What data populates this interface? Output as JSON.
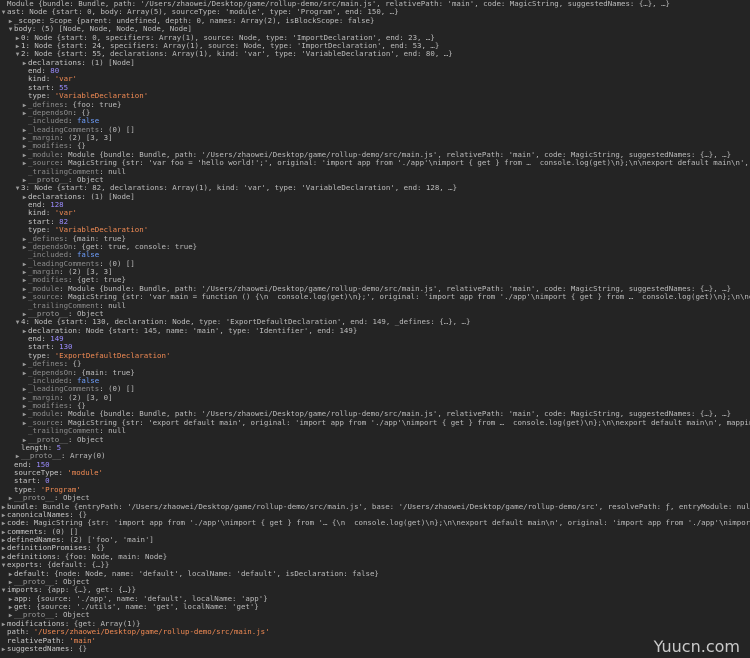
{
  "watermark": "Yuucn.com",
  "lines": [
    {
      "d": 0,
      "t": "none",
      "k": "",
      "v": "Module {bundle: Bundle, path: '/Users/zhaowei/Desktop/game/rollup-demo/src/main.js', relativePath: 'main', code: MagicString, suggestedNames: {…}, …}",
      "vc": "preview"
    },
    {
      "d": 0,
      "t": "open",
      "k": "ast",
      "v": "Node {start: 0, body: Array(5), sourceType: 'module', type: 'Program', end: 150, …}",
      "vc": "preview"
    },
    {
      "d": 1,
      "t": "closed",
      "k": "_scope",
      "v": "Scope {parent: undefined, depth: 0, names: Array(2), isBlockScope: false}",
      "vc": "preview"
    },
    {
      "d": 1,
      "t": "open",
      "k": "body",
      "v": "(5) [Node, Node, Node, Node, Node]",
      "vc": "preview"
    },
    {
      "d": 2,
      "t": "closed",
      "k": "0",
      "v": "Node {start: 0, specifiers: Array(1), source: Node, type: 'ImportDeclaration', end: 23, …}",
      "vc": "preview"
    },
    {
      "d": 2,
      "t": "closed",
      "k": "1",
      "v": "Node {start: 24, specifiers: Array(1), source: Node, type: 'ImportDeclaration', end: 53, …}",
      "vc": "preview"
    },
    {
      "d": 2,
      "t": "open",
      "k": "2",
      "v": "Node {start: 55, declarations: Array(1), kind: 'var', type: 'VariableDeclaration', end: 80, …}",
      "vc": "preview"
    },
    {
      "d": 3,
      "t": "closed",
      "k": "declarations",
      "v": "(1) [Node]",
      "vc": "preview"
    },
    {
      "d": 3,
      "t": "none",
      "k": "end",
      "v": "80",
      "vc": "num"
    },
    {
      "d": 3,
      "t": "none",
      "k": "kind",
      "v": "'var'",
      "vc": "str"
    },
    {
      "d": 3,
      "t": "none",
      "k": "start",
      "v": "55",
      "vc": "num"
    },
    {
      "d": 3,
      "t": "none",
      "k": "type",
      "v": "'VariableDeclaration'",
      "vc": "str"
    },
    {
      "d": 3,
      "t": "closed",
      "k": "_defines",
      "v": "{foo: true}",
      "vc": "preview",
      "kc": "faded"
    },
    {
      "d": 3,
      "t": "closed",
      "k": "_dependsOn",
      "v": "{}",
      "vc": "preview",
      "kc": "faded"
    },
    {
      "d": 3,
      "t": "none",
      "k": "_included",
      "v": "false",
      "vc": "kw",
      "kc": "faded"
    },
    {
      "d": 3,
      "t": "closed",
      "k": "_leadingComments",
      "v": "(0) []",
      "vc": "preview",
      "kc": "faded"
    },
    {
      "d": 3,
      "t": "closed",
      "k": "_margin",
      "v": "(2) [3, 3]",
      "vc": "preview",
      "kc": "faded"
    },
    {
      "d": 3,
      "t": "closed",
      "k": "_modifies",
      "v": "{}",
      "vc": "preview",
      "kc": "faded"
    },
    {
      "d": 3,
      "t": "closed",
      "k": "_module",
      "v": "Module {bundle: Bundle, path: '/Users/zhaowei/Desktop/game/rollup-demo/src/main.js', relativePath: 'main', code: MagicString, suggestedNames: {…}, …}",
      "vc": "preview",
      "kc": "faded"
    },
    {
      "d": 3,
      "t": "closed",
      "k": "_source",
      "v": "MagicString {str: 'var foo = 'hello world!';', original: 'import app from './app'\\nimport { get } from …  console.log(get)\\n};\\n\\nexport default main\\n', mappings: Uint32Array(150), fil",
      "vc": "preview",
      "kc": "faded"
    },
    {
      "d": 3,
      "t": "none",
      "k": "_trailingComment",
      "v": "null",
      "vc": "val",
      "kc": "faded"
    },
    {
      "d": 3,
      "t": "closed",
      "k": "__proto__",
      "v": "Object",
      "vc": "val",
      "kc": "proto"
    },
    {
      "d": 2,
      "t": "open",
      "k": "3",
      "v": "Node {start: 82, declarations: Array(1), kind: 'var', type: 'VariableDeclaration', end: 128, …}",
      "vc": "preview"
    },
    {
      "d": 3,
      "t": "closed",
      "k": "declarations",
      "v": "(1) [Node]",
      "vc": "preview"
    },
    {
      "d": 3,
      "t": "none",
      "k": "end",
      "v": "128",
      "vc": "num"
    },
    {
      "d": 3,
      "t": "none",
      "k": "kind",
      "v": "'var'",
      "vc": "str"
    },
    {
      "d": 3,
      "t": "none",
      "k": "start",
      "v": "82",
      "vc": "num"
    },
    {
      "d": 3,
      "t": "none",
      "k": "type",
      "v": "'VariableDeclaration'",
      "vc": "str"
    },
    {
      "d": 3,
      "t": "closed",
      "k": "_defines",
      "v": "{main: true}",
      "vc": "preview",
      "kc": "faded"
    },
    {
      "d": 3,
      "t": "closed",
      "k": "_dependsOn",
      "v": "{get: true, console: true}",
      "vc": "preview",
      "kc": "faded"
    },
    {
      "d": 3,
      "t": "none",
      "k": "_included",
      "v": "false",
      "vc": "kw",
      "kc": "faded"
    },
    {
      "d": 3,
      "t": "closed",
      "k": "_leadingComments",
      "v": "(0) []",
      "vc": "preview",
      "kc": "faded"
    },
    {
      "d": 3,
      "t": "closed",
      "k": "_margin",
      "v": "(2) [3, 3]",
      "vc": "preview",
      "kc": "faded"
    },
    {
      "d": 3,
      "t": "closed",
      "k": "_modifies",
      "v": "{get: true}",
      "vc": "preview",
      "kc": "faded"
    },
    {
      "d": 3,
      "t": "closed",
      "k": "_module",
      "v": "Module {bundle: Bundle, path: '/Users/zhaowei/Desktop/game/rollup-demo/src/main.js', relativePath: 'main', code: MagicString, suggestedNames: {…}, …}",
      "vc": "preview",
      "kc": "faded"
    },
    {
      "d": 3,
      "t": "closed",
      "k": "_source",
      "v": "MagicString {str: 'var main = function () {\\n  console.log(get)\\n};', original: 'import app from './app'\\nimport { get } from …  console.log(get)\\n};\\n\\nexport default main\\n', mappings",
      "vc": "preview",
      "kc": "faded"
    },
    {
      "d": 3,
      "t": "none",
      "k": "_trailingComment",
      "v": "null",
      "vc": "val",
      "kc": "faded"
    },
    {
      "d": 3,
      "t": "closed",
      "k": "__proto__",
      "v": "Object",
      "vc": "val",
      "kc": "proto"
    },
    {
      "d": 2,
      "t": "open",
      "k": "4",
      "v": "Node {start: 130, declaration: Node, type: 'ExportDefaultDeclaration', end: 149, _defines: {…}, …}",
      "vc": "preview"
    },
    {
      "d": 3,
      "t": "closed",
      "k": "declaration",
      "v": "Node {start: 145, name: 'main', type: 'Identifier', end: 149}",
      "vc": "preview"
    },
    {
      "d": 3,
      "t": "none",
      "k": "end",
      "v": "149",
      "vc": "num"
    },
    {
      "d": 3,
      "t": "none",
      "k": "start",
      "v": "130",
      "vc": "num"
    },
    {
      "d": 3,
      "t": "none",
      "k": "type",
      "v": "'ExportDefaultDeclaration'",
      "vc": "str"
    },
    {
      "d": 3,
      "t": "closed",
      "k": "_defines",
      "v": "{}",
      "vc": "preview",
      "kc": "faded"
    },
    {
      "d": 3,
      "t": "closed",
      "k": "_dependsOn",
      "v": "{main: true}",
      "vc": "preview",
      "kc": "faded"
    },
    {
      "d": 3,
      "t": "none",
      "k": "_included",
      "v": "false",
      "vc": "kw",
      "kc": "faded"
    },
    {
      "d": 3,
      "t": "closed",
      "k": "_leadingComments",
      "v": "(0) []",
      "vc": "preview",
      "kc": "faded"
    },
    {
      "d": 3,
      "t": "closed",
      "k": "_margin",
      "v": "(2) [3, 0]",
      "vc": "preview",
      "kc": "faded"
    },
    {
      "d": 3,
      "t": "closed",
      "k": "_modifies",
      "v": "{}",
      "vc": "preview",
      "kc": "faded"
    },
    {
      "d": 3,
      "t": "closed",
      "k": "_module",
      "v": "Module {bundle: Bundle, path: '/Users/zhaowei/Desktop/game/rollup-demo/src/main.js', relativePath: 'main', code: MagicString, suggestedNames: {…}, …}",
      "vc": "preview",
      "kc": "faded"
    },
    {
      "d": 3,
      "t": "closed",
      "k": "_source",
      "v": "MagicString {str: 'export default main', original: 'import app from './app'\\nimport { get } from …  console.log(get)\\n};\\n\\nexport default main\\n', mappings: Uint32Array(150), filename:",
      "vc": "preview",
      "kc": "faded"
    },
    {
      "d": 3,
      "t": "none",
      "k": "_trailingComment",
      "v": "null",
      "vc": "val",
      "kc": "faded"
    },
    {
      "d": 3,
      "t": "closed",
      "k": "__proto__",
      "v": "Object",
      "vc": "val",
      "kc": "proto"
    },
    {
      "d": 2,
      "t": "none",
      "k": "length",
      "v": "5",
      "vc": "num"
    },
    {
      "d": 2,
      "t": "closed",
      "k": "__proto__",
      "v": "Array(0)",
      "vc": "val",
      "kc": "proto"
    },
    {
      "d": 1,
      "t": "none",
      "k": "end",
      "v": "150",
      "vc": "num"
    },
    {
      "d": 1,
      "t": "none",
      "k": "sourceType",
      "v": "'module'",
      "vc": "str"
    },
    {
      "d": 1,
      "t": "none",
      "k": "start",
      "v": "0",
      "vc": "num"
    },
    {
      "d": 1,
      "t": "none",
      "k": "type",
      "v": "'Program'",
      "vc": "str"
    },
    {
      "d": 1,
      "t": "closed",
      "k": "__proto__",
      "v": "Object",
      "vc": "val",
      "kc": "proto"
    },
    {
      "d": 0,
      "t": "closed",
      "k": "bundle",
      "v": "Bundle {entryPath: '/Users/zhaowei/Desktop/game/rollup-demo/src/main.js', base: '/Users/zhaowei/Desktop/game/rollup-demo/src', resolvePath: ƒ, entryModule: null, modulePromises: {…}, …}",
      "vc": "preview"
    },
    {
      "d": 0,
      "t": "closed",
      "k": "canonicalNames",
      "v": "{}",
      "vc": "preview"
    },
    {
      "d": 0,
      "t": "closed",
      "k": "code",
      "v": "MagicString {str: 'import app from './app'\\nimport { get } from '… {\\n  console.log(get)\\n};\\n\\nexport default main\\n', original: 'import app from './app'\\nimport { get } from …  console.lo",
      "vc": "preview"
    },
    {
      "d": 0,
      "t": "closed",
      "k": "comments",
      "v": "(0) []",
      "vc": "preview"
    },
    {
      "d": 0,
      "t": "closed",
      "k": "definedNames",
      "v": "(2) ['foo', 'main']",
      "vc": "preview"
    },
    {
      "d": 0,
      "t": "closed",
      "k": "definitionPromises",
      "v": "{}",
      "vc": "preview"
    },
    {
      "d": 0,
      "t": "closed",
      "k": "definitions",
      "v": "{foo: Node, main: Node}",
      "vc": "preview"
    },
    {
      "d": 0,
      "t": "open",
      "k": "exports",
      "v": "{default: {…}}",
      "vc": "preview"
    },
    {
      "d": 1,
      "t": "closed",
      "k": "default",
      "v": "{node: Node, name: 'default', localName: 'default', isDeclaration: false}",
      "vc": "preview"
    },
    {
      "d": 1,
      "t": "closed",
      "k": "__proto__",
      "v": "Object",
      "vc": "val",
      "kc": "proto"
    },
    {
      "d": 0,
      "t": "open",
      "k": "imports",
      "v": "{app: {…}, get: {…}}",
      "vc": "preview"
    },
    {
      "d": 1,
      "t": "closed",
      "k": "app",
      "v": "{source: './app', name: 'default', localName: 'app'}",
      "vc": "preview"
    },
    {
      "d": 1,
      "t": "closed",
      "k": "get",
      "v": "{source: './utils', name: 'get', localName: 'get'}",
      "vc": "preview"
    },
    {
      "d": 1,
      "t": "closed",
      "k": "__proto__",
      "v": "Object",
      "vc": "val",
      "kc": "proto"
    },
    {
      "d": 0,
      "t": "closed",
      "k": "modifications",
      "v": "{get: Array(1)}",
      "vc": "preview"
    },
    {
      "d": 0,
      "t": "none",
      "k": "path",
      "v": "'/Users/zhaowei/Desktop/game/rollup-demo/src/main.js'",
      "vc": "str"
    },
    {
      "d": 0,
      "t": "none",
      "k": "relativePath",
      "v": "'main'",
      "vc": "str"
    },
    {
      "d": 0,
      "t": "closed",
      "k": "suggestedNames",
      "v": "{}",
      "vc": "preview"
    }
  ]
}
